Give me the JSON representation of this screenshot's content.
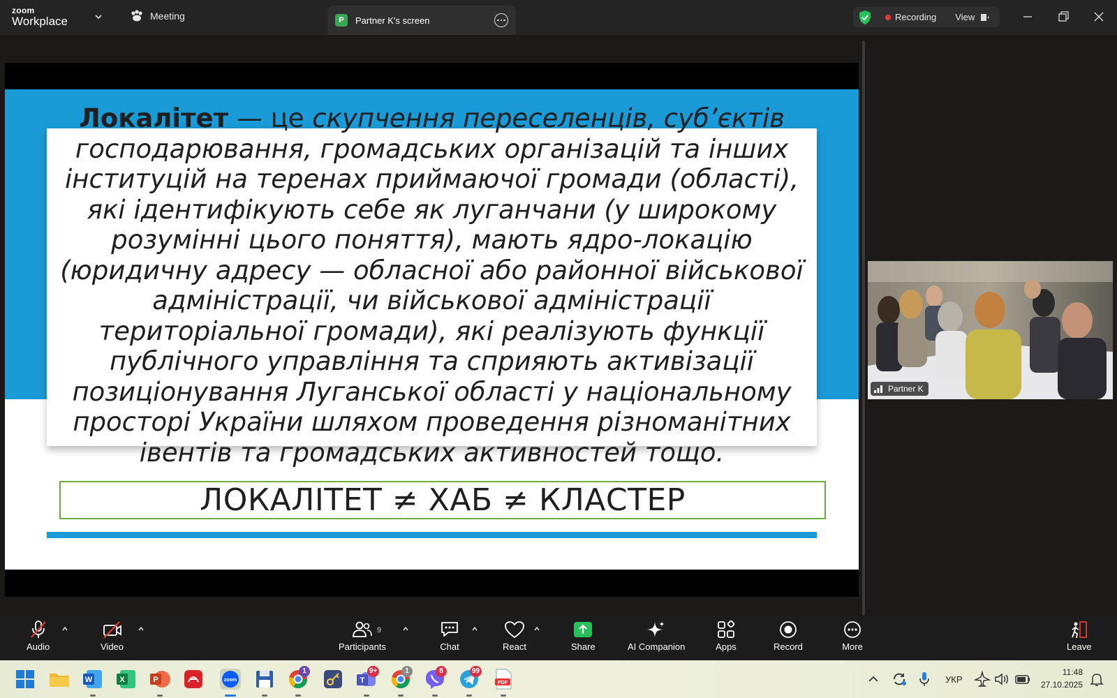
{
  "titlebar": {
    "logo_top": "zoom",
    "logo_bottom": "Workplace",
    "meeting_tab": "Meeting",
    "screen_tab_badge": "P",
    "screen_tab": "Partner K's screen",
    "recording": "Recording",
    "view": "View"
  },
  "slide": {
    "term": "Локалітет",
    "dash": " — це ",
    "definition": "скупчення переселенців, суб’єктів господарювання, громадських організацій та інших інституцій на теренах приймаючої громади (області), які ідентифікують себе як луганчани (у широкому розумінні цього поняття), мають ядро-локацію (юридичну адресу — обласної або районної військової адміністрації, чи військової адміністрації територіальної громади), які реалізують функції публічного управління та сприяють активізації позиціонування Луганської області у національному просторі України шляхом проведення різноманітних івентів та громадських активностей тощо.",
    "equation": "ЛОКАЛІТЕТ ≠ ХАБ ≠ КЛАСТЕР"
  },
  "video": {
    "name": "Partner K"
  },
  "toolbar": {
    "audio": "Audio",
    "video": "Video",
    "participants": "Participants",
    "participants_count": "9",
    "chat": "Chat",
    "react": "React",
    "share": "Share",
    "ai_companion": "AI Companion",
    "apps": "Apps",
    "record": "Record",
    "more": "More",
    "leave": "Leave"
  },
  "taskbar": {
    "badges": {
      "chrome": "1",
      "teams": "9+",
      "chrome2": "1",
      "viber": "8",
      "telegram": "99"
    },
    "language": "УКР",
    "time": "11:48",
    "date": "27.10.2025"
  },
  "colors": {
    "slide_blue": "#1a9ad6",
    "eq_border": "#6aaf3d",
    "share_green": "#27c15b",
    "recording_red": "#e53935"
  }
}
